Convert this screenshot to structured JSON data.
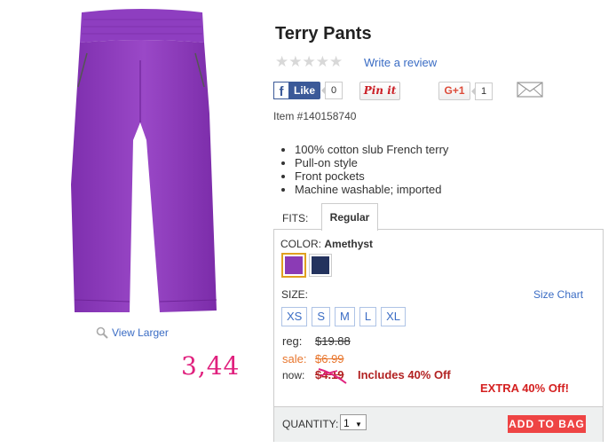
{
  "product": {
    "title": "Terry Pants",
    "rating_stars": "★★★★★",
    "write_review": "Write a review",
    "item_number": "Item #140158740",
    "bullets": [
      "100% cotton slub French terry",
      "Pull-on style",
      "Front pockets",
      "Machine washable; imported"
    ],
    "view_larger": "View Larger",
    "image_icon": "pants-image"
  },
  "social": {
    "facebook_icon": "f",
    "facebook_label": "Like",
    "facebook_count": "0",
    "pinterest_label": "Pin it",
    "gplus_label": "G+1",
    "gplus_count": "1",
    "email_icon": "envelope-icon"
  },
  "fits": {
    "label": "FITS:",
    "selected_tab": "Regular"
  },
  "color": {
    "label": "COLOR:",
    "selected": "Amethyst",
    "swatches": [
      "#8b3bb5",
      "#24335e"
    ]
  },
  "size": {
    "label": "SIZE:",
    "chart_link": "Size Chart",
    "options": [
      "XS",
      "S",
      "M",
      "L",
      "XL"
    ]
  },
  "pricing": {
    "reg_label": "reg:",
    "reg_value": "$19.88",
    "sale_label": "sale:",
    "sale_value": "$6.99",
    "now_label": "now:",
    "now_value": "$4.19",
    "includes_text": "Includes 40% Off",
    "extra_text": "EXTRA 40% Off!",
    "handwritten_note": "3,44"
  },
  "quantity": {
    "label": "QUANTITY:",
    "value": "1"
  },
  "add_to_bag": "ADD TO BAG",
  "colors": {
    "link": "#3a6cc4",
    "sale": "#e8762d",
    "now": "#b22222",
    "button": "#ee4444",
    "handwriting": "#e0217e"
  }
}
